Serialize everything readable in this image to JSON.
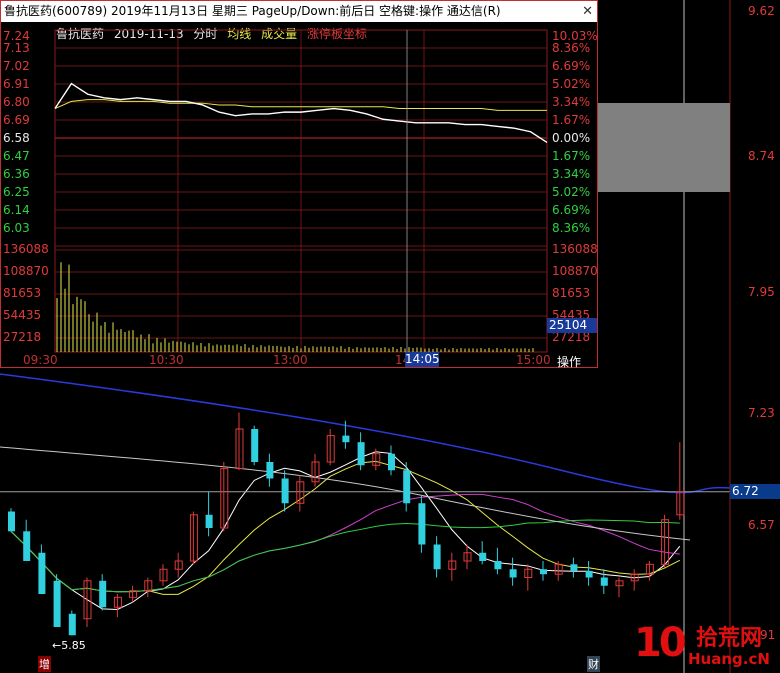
{
  "window": {
    "title": "鲁抗医药(600789) 2019年11月13日 星期三 PageUp/Down:前后日 空格键:操作 通达信(R)",
    "close_glyph": "✕"
  },
  "info_bar": {
    "stock_name": "鲁抗医药",
    "date": "2019-11-13",
    "mode": "分时",
    "avg_line": "均线",
    "volume": "成交量",
    "limit_coords": "涨停板坐标"
  },
  "intraday_price_labels": [
    "7.24",
    "7.13",
    "7.02",
    "6.91",
    "6.80",
    "6.69",
    "6.58",
    "6.47",
    "6.36",
    "6.25",
    "6.14",
    "6.03"
  ],
  "intraday_pct_labels": [
    "10.03%",
    "8.36%",
    "6.69%",
    "5.02%",
    "3.34%",
    "1.67%",
    "0.00%",
    "1.67%",
    "3.34%",
    "5.02%",
    "6.69%",
    "8.36%"
  ],
  "volume_labels": [
    "136088",
    "108870",
    "81653",
    "54435",
    "27218"
  ],
  "volume_cursor": "25104",
  "time_labels": [
    "09:30",
    "10:30",
    "13:00",
    "14",
    "15:00"
  ],
  "time_cursor": "14:05",
  "op_button": "操作",
  "kline_axis": {
    "labels": [
      "9.62",
      "8.74",
      "7.95",
      "7.23",
      "6.57"
    ],
    "partial_bottom": "91",
    "current_price": "6.72",
    "low_label": "←5.85"
  },
  "markers": {
    "zeng": "增",
    "cai": "财"
  },
  "watermark": {
    "number": "10",
    "chinese": "拾荒网",
    "site": "Huang.cN"
  },
  "colors": {
    "up": "#e03a3a",
    "down": "#30d0e0",
    "bg": "#000000",
    "grid": "#8a1a1a"
  },
  "chart_data": [
    {
      "type": "line",
      "name_of_view": "intraday",
      "series": [
        {
          "values": [
            6.8,
            6.94,
            6.88,
            6.86,
            6.85,
            6.86,
            6.85,
            6.84,
            6.84,
            6.82,
            6.78,
            6.76,
            6.77,
            6.77,
            6.78,
            6.78,
            6.79,
            6.8,
            6.79,
            6.77,
            6.74,
            6.73,
            6.72,
            6.72,
            6.72,
            6.71,
            6.71,
            6.7,
            6.69,
            6.67,
            6.61
          ]
        },
        {
          "values": [
            6.8,
            6.84,
            6.85,
            6.85,
            6.84,
            6.84,
            6.84,
            6.83,
            6.83,
            6.83,
            6.82,
            6.82,
            6.81,
            6.81,
            6.81,
            6.81,
            6.81,
            6.81,
            6.81,
            6.81,
            6.81,
            6.8,
            6.8,
            6.8,
            6.8,
            6.8,
            6.8,
            6.79,
            6.79,
            6.79,
            6.79
          ]
        }
      ],
      "ylim": [
        6.03,
        7.24
      ]
    },
    {
      "type": "candlestick",
      "name_of_view": "daily",
      "candles": [
        [
          6.6,
          6.62,
          6.5,
          6.48
        ],
        [
          6.48,
          6.55,
          6.35,
          6.3
        ],
        [
          6.35,
          6.4,
          6.18,
          6.1
        ],
        [
          6.18,
          6.22,
          5.95,
          5.9
        ],
        [
          5.98,
          6.0,
          5.85,
          5.85
        ],
        [
          5.95,
          6.2,
          5.9,
          6.18
        ],
        [
          6.18,
          6.22,
          6.0,
          6.02
        ],
        [
          6.02,
          6.1,
          5.96,
          6.08
        ],
        [
          6.08,
          6.15,
          6.05,
          6.12
        ],
        [
          6.12,
          6.2,
          6.08,
          6.18
        ],
        [
          6.18,
          6.28,
          6.15,
          6.25
        ],
        [
          6.25,
          6.35,
          6.2,
          6.3
        ],
        [
          6.3,
          6.6,
          6.28,
          6.58
        ],
        [
          6.58,
          6.72,
          6.45,
          6.5
        ],
        [
          6.5,
          6.9,
          6.48,
          6.86
        ],
        [
          6.86,
          7.2,
          6.85,
          7.1
        ],
        [
          7.1,
          7.12,
          6.88,
          6.9
        ],
        [
          6.9,
          6.95,
          6.75,
          6.8
        ],
        [
          6.8,
          6.85,
          6.6,
          6.65
        ],
        [
          6.65,
          6.82,
          6.6,
          6.78
        ],
        [
          6.78,
          6.95,
          6.75,
          6.9
        ],
        [
          6.9,
          7.1,
          6.88,
          7.06
        ],
        [
          7.06,
          7.15,
          6.98,
          7.02
        ],
        [
          7.02,
          7.08,
          6.85,
          6.88
        ],
        [
          6.88,
          6.98,
          6.85,
          6.95
        ],
        [
          6.95,
          7.0,
          6.82,
          6.85
        ],
        [
          6.85,
          6.9,
          6.6,
          6.65
        ],
        [
          6.65,
          6.7,
          6.35,
          6.4
        ],
        [
          6.4,
          6.45,
          6.2,
          6.25
        ],
        [
          6.25,
          6.35,
          6.18,
          6.3
        ],
        [
          6.3,
          6.4,
          6.25,
          6.35
        ],
        [
          6.35,
          6.42,
          6.28,
          6.3
        ],
        [
          6.3,
          6.38,
          6.22,
          6.25
        ],
        [
          6.25,
          6.32,
          6.15,
          6.2
        ],
        [
          6.2,
          6.28,
          6.12,
          6.25
        ],
        [
          6.25,
          6.3,
          6.18,
          6.22
        ],
        [
          6.22,
          6.3,
          6.18,
          6.28
        ],
        [
          6.28,
          6.32,
          6.2,
          6.24
        ],
        [
          6.24,
          6.3,
          6.15,
          6.2
        ],
        [
          6.2,
          6.25,
          6.1,
          6.15
        ],
        [
          6.15,
          6.2,
          6.08,
          6.18
        ],
        [
          6.18,
          6.25,
          6.12,
          6.22
        ],
        [
          6.22,
          6.3,
          6.18,
          6.28
        ],
        [
          6.28,
          6.58,
          6.26,
          6.55
        ],
        [
          6.58,
          7.02,
          6.55,
          6.72
        ]
      ],
      "ylim": [
        5.7,
        9.7
      ]
    }
  ]
}
